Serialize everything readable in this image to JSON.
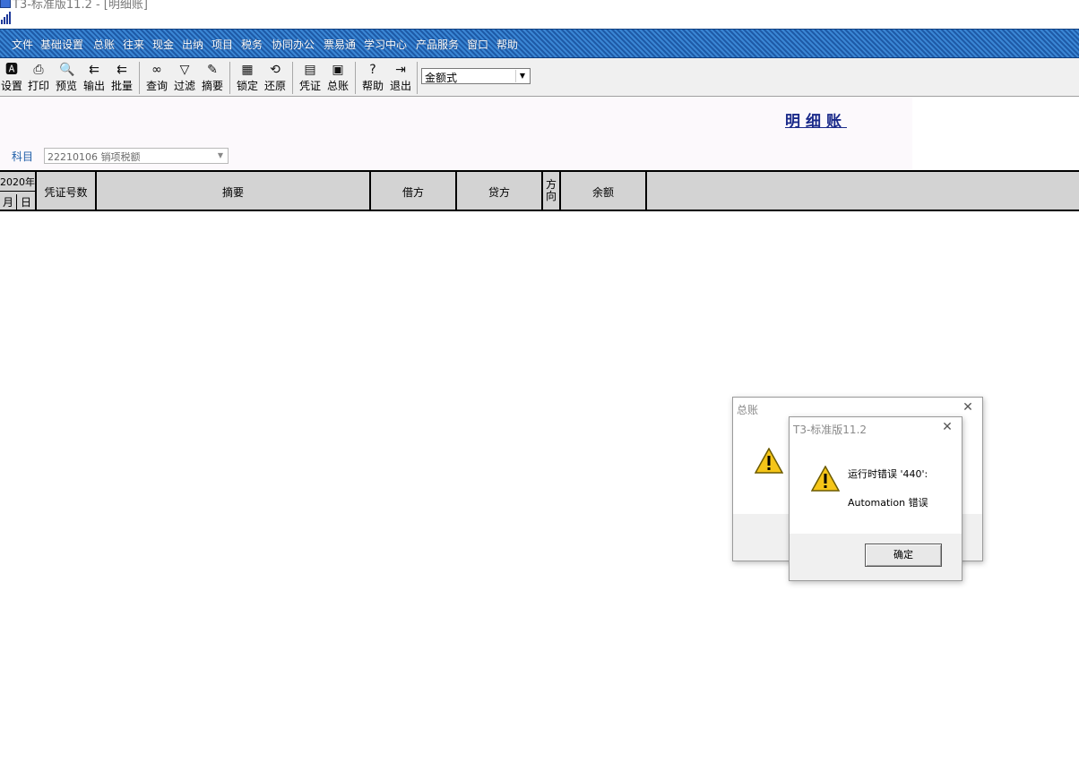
{
  "window": {
    "title": "T3-标准版11.2 - [明细账]"
  },
  "menu": [
    "文件",
    "基础设置",
    "总账",
    "往来",
    "现金",
    "出纳",
    "项目",
    "税务",
    "协同办公",
    "票易通",
    "学习中心",
    "产品服务",
    "窗口",
    "帮助"
  ],
  "toolbar": {
    "buttons": [
      {
        "label": "设置",
        "icon": "settings-icon"
      },
      {
        "label": "打印",
        "icon": "printer-icon"
      },
      {
        "label": "预览",
        "icon": "preview-icon"
      },
      {
        "label": "输出",
        "icon": "export-icon"
      },
      {
        "label": "批量",
        "icon": "batch-icon"
      },
      {
        "label": "查询",
        "icon": "binoculars-icon"
      },
      {
        "label": "过滤",
        "icon": "filter-icon"
      },
      {
        "label": "摘要",
        "icon": "summary-icon"
      },
      {
        "label": "锁定",
        "icon": "lock-icon"
      },
      {
        "label": "还原",
        "icon": "restore-icon"
      },
      {
        "label": "凭证",
        "icon": "voucher-icon"
      },
      {
        "label": "总账",
        "icon": "ledger-icon"
      },
      {
        "label": "帮助",
        "icon": "help-icon"
      },
      {
        "label": "退出",
        "icon": "exit-icon"
      }
    ],
    "format_select": "金额式"
  },
  "report": {
    "title": "明细账",
    "subject_label": "科目",
    "subject_value": "22210106 销项税额"
  },
  "table": {
    "year": "2020年",
    "month": "月",
    "day": "日",
    "columns": [
      "凭证号数",
      "摘要",
      "借方",
      "贷方",
      "方向",
      "余额"
    ]
  },
  "dialog_back": {
    "title": "总账"
  },
  "dialog_front": {
    "title": "T3-标准版11.2",
    "message_1": "运行时错误 '440':",
    "message_2": "Automation 错误",
    "ok_label": "确定"
  },
  "colors": {
    "menubar": "#2a6fc0",
    "title_link": "#1a2a8a",
    "grid_header": "#d3d3d3"
  }
}
